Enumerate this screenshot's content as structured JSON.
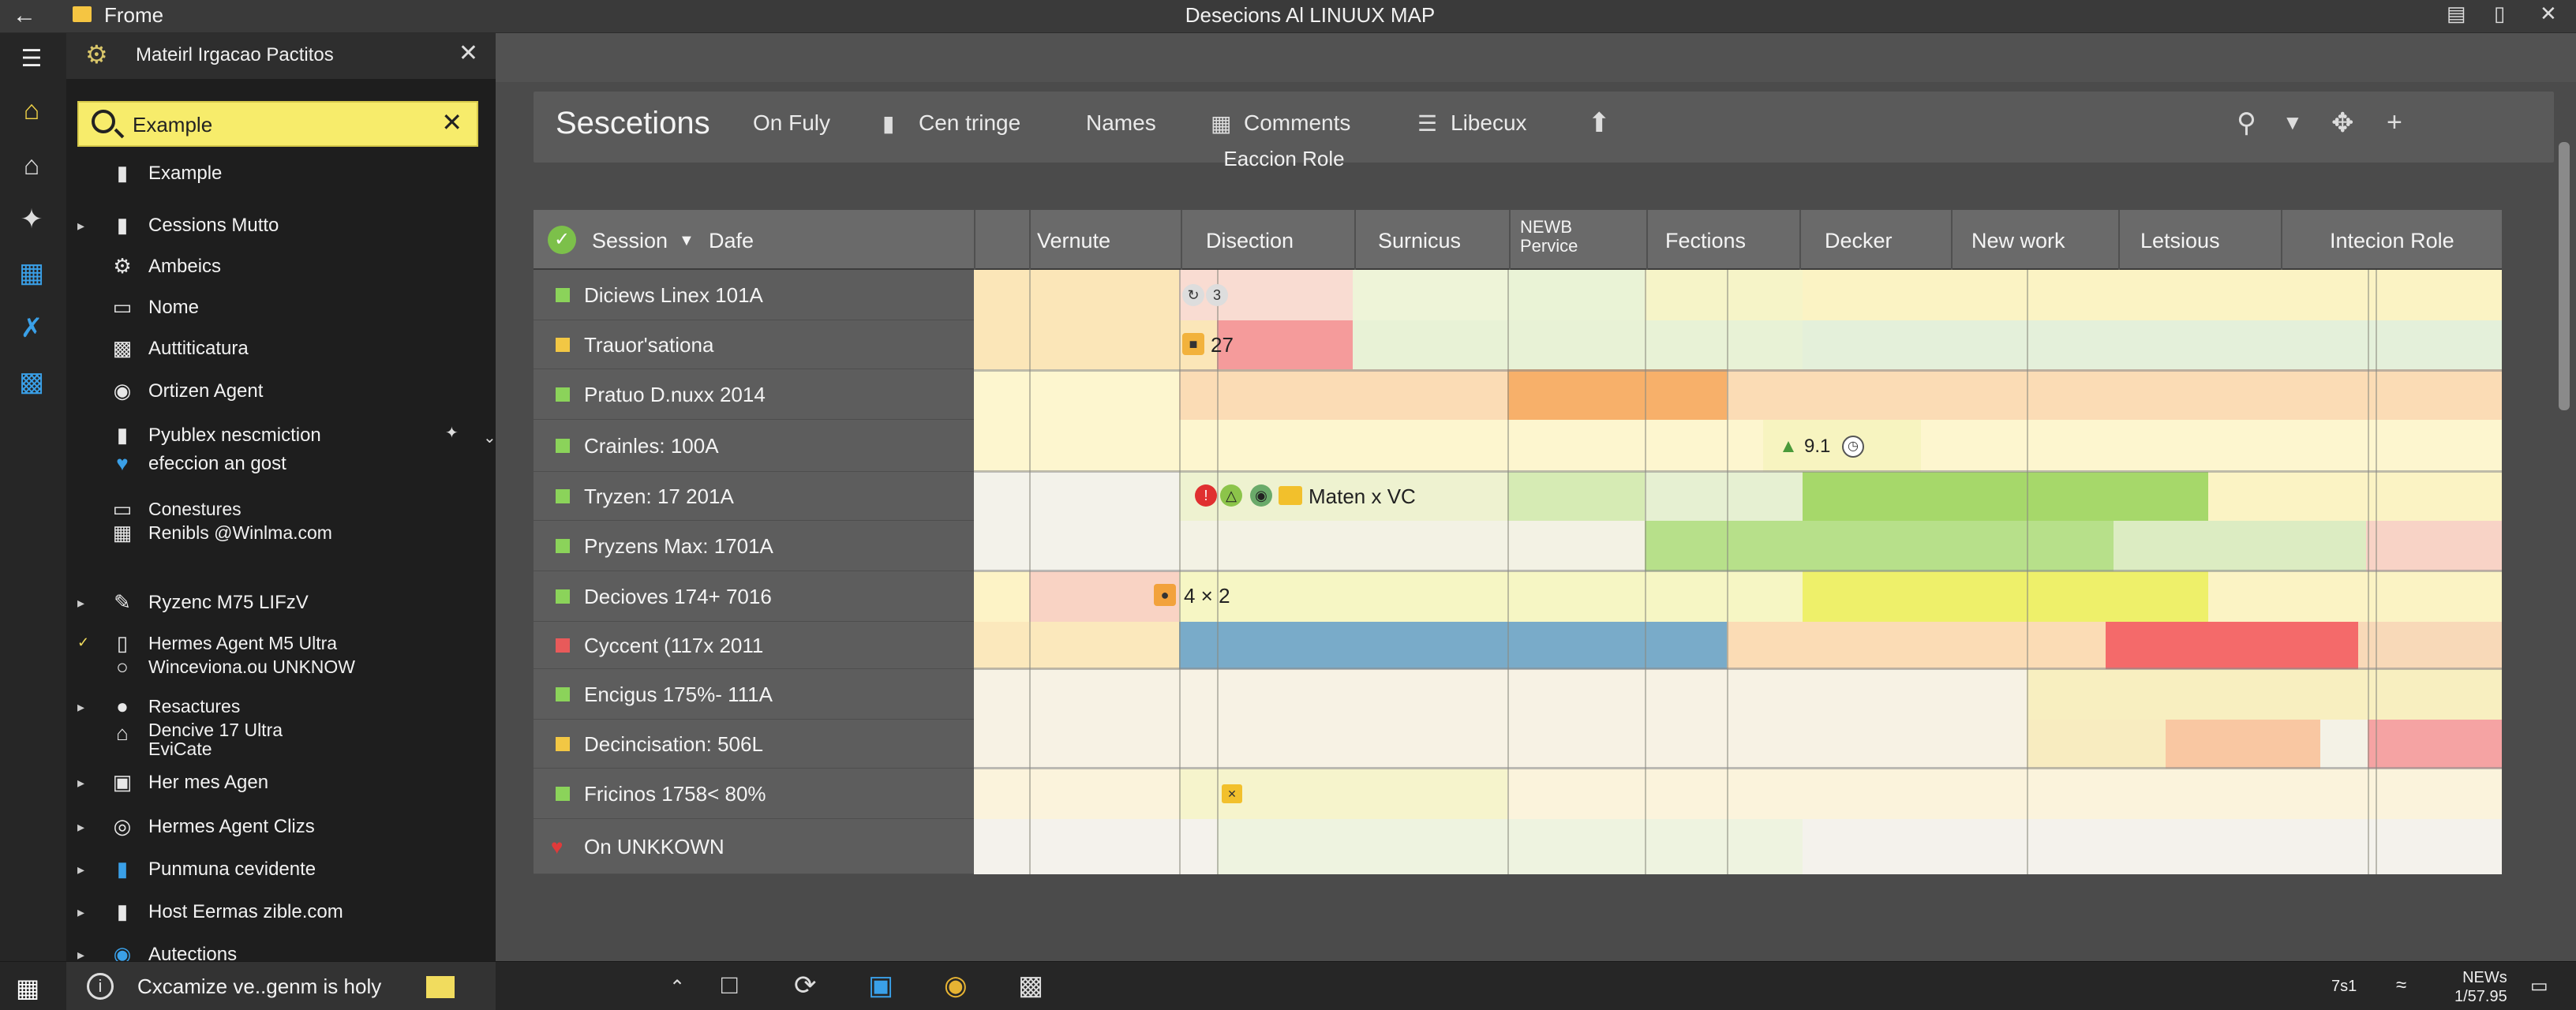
{
  "titlebar": {
    "app_name": "Frome",
    "window_title": "Desecions Al LINUUX  MAP"
  },
  "nav": {
    "header_title": "Mateirl Irgacao Pactitos",
    "search_value": "Example",
    "items": [
      {
        "label": "Example",
        "icon": "folder-icon"
      },
      {
        "label": "Cessions Mutto",
        "icon": "document-icon"
      },
      {
        "label": "Ambeics",
        "icon": "gear-icon"
      },
      {
        "label": "Nome",
        "icon": "monitor-icon"
      },
      {
        "label": "Auttiticatura",
        "icon": "network-icon"
      },
      {
        "label": "Ortizen Agent",
        "icon": "lock-icon"
      },
      {
        "label": "Pyublex nescmiction",
        "icon": "folder-icon"
      },
      {
        "label": "efeccion an gost",
        "icon": "heart-icon"
      },
      {
        "label": "Conestures",
        "icon": "monitor-icon"
      },
      {
        "label": "Renibls @Winlma.com",
        "icon": "grid-icon"
      },
      {
        "label": "Ryzenc M75 LIFzV",
        "icon": "edit-icon"
      },
      {
        "label": "Hermes Agent M5 Ultra",
        "icon": "phone-icon"
      },
      {
        "label": "Winceviona.ou UNKNOW",
        "icon": "circle-icon"
      },
      {
        "label": "Resactures",
        "icon": "user-icon"
      },
      {
        "label": "Dencive 17 Ultra",
        "icon": "home-icon"
      },
      {
        "label": "EviCate",
        "icon": "home-icon"
      },
      {
        "label": "Her mes Agen",
        "icon": "image-icon"
      },
      {
        "label": "Hermes Agent Clizs",
        "icon": "disc-icon"
      },
      {
        "label": "Punmuna cevidente",
        "icon": "folder-icon"
      },
      {
        "label": "Host Eermas zible.com",
        "icon": "document-icon"
      },
      {
        "label": "Autections",
        "icon": "globe-icon"
      }
    ]
  },
  "toolbar": {
    "title": "Sescetions",
    "items": [
      "On Fuly",
      "Cen tringe",
      "Names",
      "Comments",
      "Libecux"
    ]
  },
  "grid": {
    "caption": "Eaccion Role",
    "name_header_session": "Session",
    "name_header_date": "Dafe",
    "columns": [
      "Vernute",
      "Disection",
      "Surnicus",
      "NEWB",
      "Pervice",
      "Fections",
      "Decker",
      "New work",
      "Letsious",
      "Intecion Role"
    ],
    "rows": [
      {
        "label": "Diciews Linex 101A",
        "marker": "#8bd35a"
      },
      {
        "label": "Trauor'sationa",
        "marker": "#f2c744"
      },
      {
        "label": "Pratuo D.nuxx 2014",
        "marker": "#8bd35a"
      },
      {
        "label": "Crainles: 100A",
        "marker": "#8bd35a"
      },
      {
        "label": "Tryzen: 17 201A",
        "marker": "#8bd35a"
      },
      {
        "label": "Pryzens Max: 1701A",
        "marker": "#8bd35a"
      },
      {
        "label": "Decioves 174+ 7016",
        "marker": "#8bd35a"
      },
      {
        "label": "Cyccent (117x 2011",
        "marker": "#e85a5a"
      },
      {
        "label": "Encigus 175%- 111A",
        "marker": "#8bd35a"
      },
      {
        "label": "Decincisation: 506L",
        "marker": "#f2c744"
      },
      {
        "label": "Fricinos 1758< 80%",
        "marker": "#8bd35a"
      },
      {
        "label": "On UNKKOWN",
        "marker": "#e03a3a"
      }
    ],
    "cell_texts": {
      "r2": "27",
      "r4": "9.1",
      "r5": "Maten x VC",
      "r7": "4 × 2"
    }
  },
  "taskbar": {
    "notification": "Cxcamize ve..genm is holy",
    "page_indicator": "7s1",
    "clock_line1": "NEWs",
    "clock_line2": "1/57.95"
  },
  "colors": {
    "search_bg": "#f7ec6b",
    "orange": "#f5ad62",
    "red": "#f08a8a",
    "blue": "#79abc9",
    "green": "#a6d86a",
    "yellow": "#eef06a"
  }
}
